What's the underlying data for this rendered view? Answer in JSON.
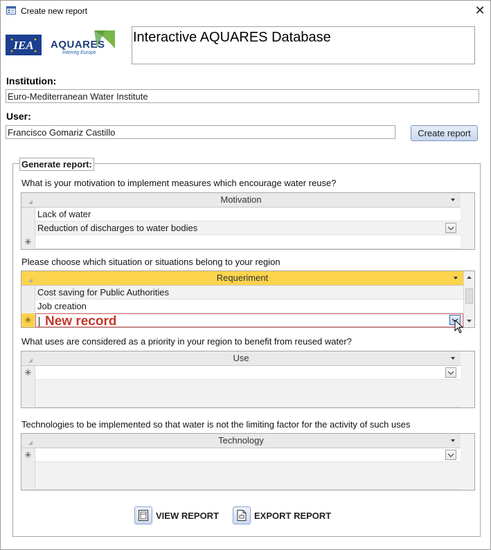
{
  "window": {
    "title": "Create new report",
    "close_symbol": "✕"
  },
  "logos": {
    "iea_text": "IEA",
    "aquares_name": "AQUARES",
    "aquares_sub": "Interreg Europe"
  },
  "db_title": "Interactive AQUARES Database",
  "institution": {
    "label": "Institution:",
    "value": "Euro-Mediterranean Water Institute"
  },
  "user": {
    "label": "User:",
    "value": "Francisco Gomariz Castillo"
  },
  "create_report_button": "Create report",
  "generate_report": {
    "legend": "Generate report:",
    "motivation": {
      "question": "What is your motivation to implement measures which encourage water reuse?",
      "column": "Motivation",
      "rows": [
        "Lack of water",
        "Reduction of discharges to water bodies"
      ],
      "new_row_symbol": "✳"
    },
    "requirement": {
      "question": "Please choose which situation or situations belong to your region",
      "column": "Requeriment",
      "rows": [
        "Cost saving for Public Authorities",
        "Job creation"
      ],
      "new_record_text": "New record",
      "new_row_symbol": "✳"
    },
    "use": {
      "question": "What uses are considered as a priority in your region to benefit from reused water?",
      "column": "Use",
      "new_row_symbol": "✳"
    },
    "technology": {
      "question": "Technologies to be implemented so that water is not the limiting factor for the activity of such uses",
      "column": "Technology",
      "new_row_symbol": "✳"
    }
  },
  "actions": {
    "view_report": "VIEW REPORT",
    "export_report": "EXPORT REPORT"
  },
  "colors": {
    "highlight_header": "#fcd34d",
    "new_record_text": "#c0392b",
    "button_blue": "#c9d8ef"
  }
}
